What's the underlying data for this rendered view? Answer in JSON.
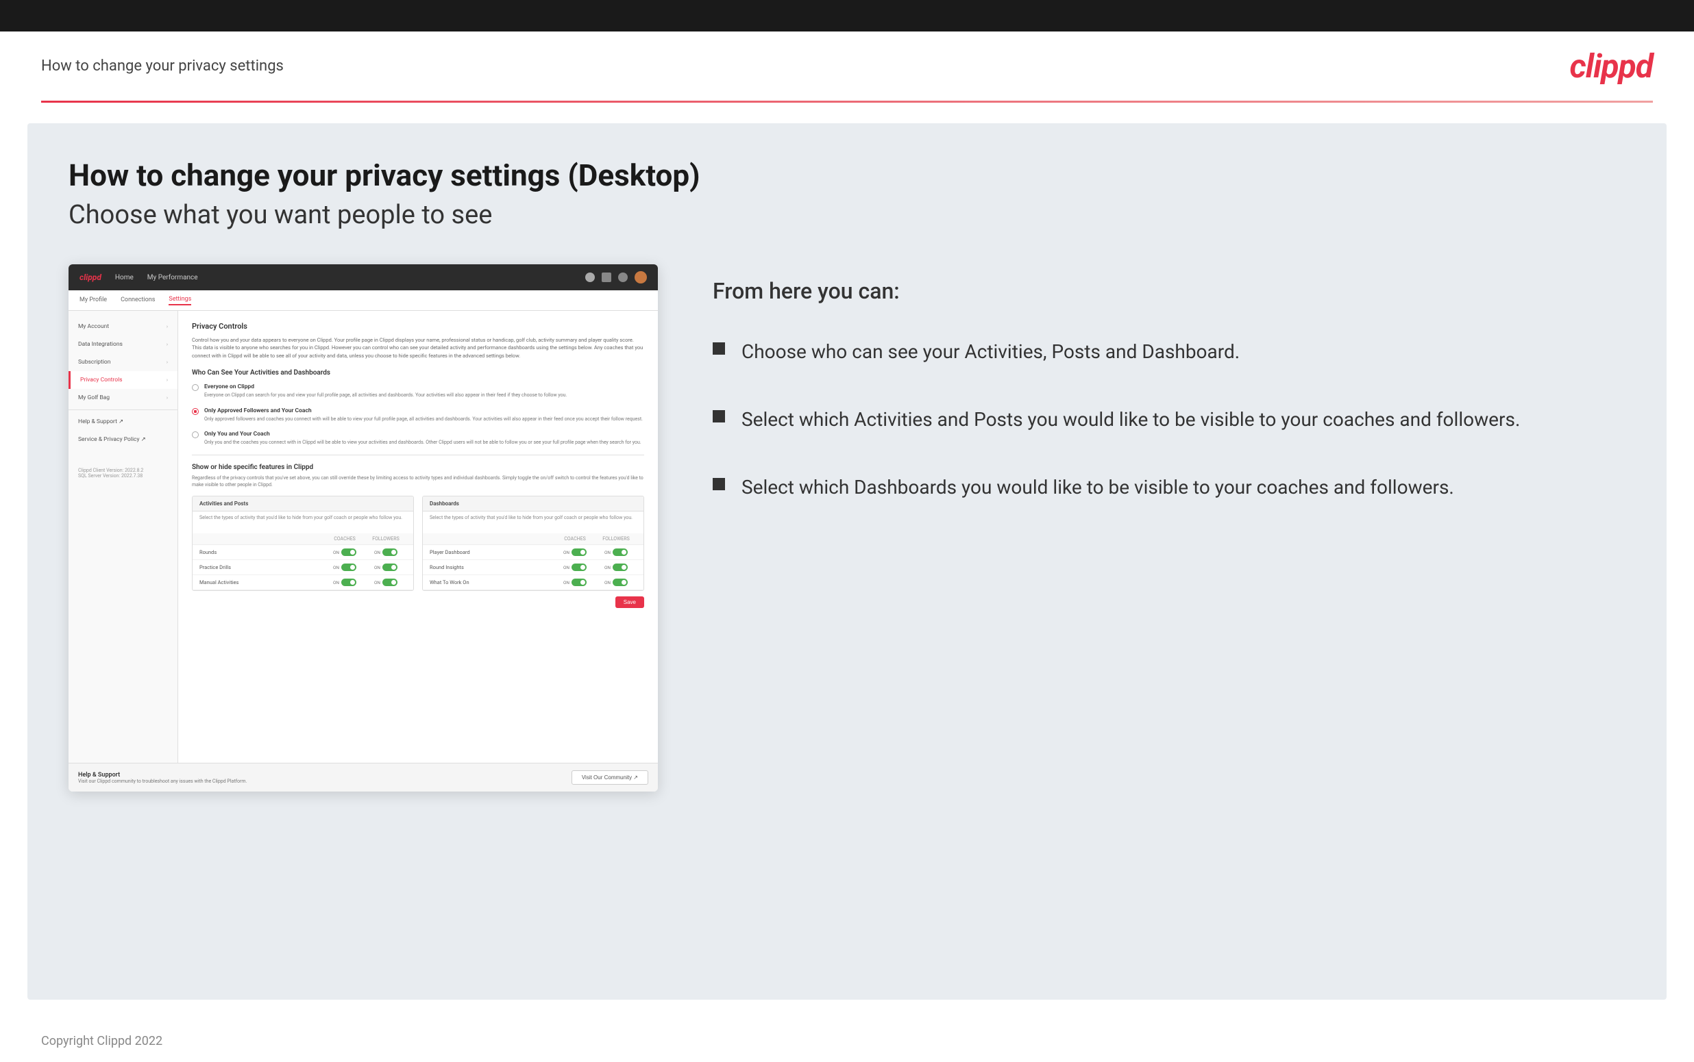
{
  "topBar": {},
  "header": {
    "title": "How to change your privacy settings",
    "logo": "clippd"
  },
  "page": {
    "heading": "How to change your privacy settings (Desktop)",
    "subheading": "Choose what you want people to see"
  },
  "mockup": {
    "nav": {
      "logo": "clippd",
      "links": [
        "Home",
        "My Performance"
      ],
      "icons": [
        "search",
        "grid",
        "settings",
        "user"
      ]
    },
    "subnav": [
      "My Profile",
      "Connections",
      "Settings"
    ],
    "activeSubnav": "Settings",
    "sidebar": {
      "items": [
        {
          "label": "My Account",
          "active": false
        },
        {
          "label": "Data Integrations",
          "active": false
        },
        {
          "label": "Subscription",
          "active": false
        },
        {
          "label": "Privacy Controls",
          "active": true
        },
        {
          "label": "My Golf Bag",
          "active": false
        },
        {
          "label": "Help & Support",
          "active": false,
          "external": true
        },
        {
          "label": "Service & Privacy Policy",
          "active": false,
          "external": true
        }
      ],
      "version": "Clippd Client Version: 2022.8.2\nSQL Server Version: 2022.7.38"
    },
    "mainPanel": {
      "sectionTitle": "Privacy Controls",
      "sectionDesc": "Control how you and your data appears to everyone on Clippd. Your profile page in Clippd displays your name, professional status or handicap, golf club, activity summary and player quality score. This data is visible to anyone who searches for you in Clippd. However you can control who can see your detailed activity and performance dashboards using the settings below. Any coaches that you connect with in Clippd will be able to see all of your activity and data, unless you choose to hide specific features in the advanced settings below.",
      "whoTitle": "Who Can See Your Activities and Dashboards",
      "options": [
        {
          "label": "Everyone on Clippd",
          "desc": "Everyone on Clippd can search for you and view your full profile page, all activities and dashboards. Your activities will also appear in their feed if they choose to follow you.",
          "selected": false
        },
        {
          "label": "Only Approved Followers and Your Coach",
          "desc": "Only approved followers and coaches you connect with will be able to view your full profile page, all activities and dashboards. Your activities will also appear in their feed once you accept their follow request.",
          "selected": true
        },
        {
          "label": "Only You and Your Coach",
          "desc": "Only you and the coaches you connect with in Clippd will be able to view your activities and dashboards. Other Clippd users will not be able to follow you or see your full profile page when they search for you.",
          "selected": false
        }
      ],
      "featuresTitle": "Show or hide specific features in Clippd",
      "featuresDesc": "Regardless of the privacy controls that you've set above, you can still override these by limiting access to activity types and individual dashboards. Simply toggle the on/off switch to control the features you'd like to make visible to other people in Clippd.",
      "activitiesTable": {
        "title": "Activities and Posts",
        "desc": "Select the types of activity that you'd like to hide from your golf coach or people who follow you.",
        "columns": [
          "COACHES",
          "FOLLOWERS"
        ],
        "rows": [
          {
            "label": "Rounds",
            "coachesOn": true,
            "followersOn": true
          },
          {
            "label": "Practice Drills",
            "coachesOn": true,
            "followersOn": true
          },
          {
            "label": "Manual Activities",
            "coachesOn": true,
            "followersOn": true
          }
        ]
      },
      "dashboardsTable": {
        "title": "Dashboards",
        "desc": "Select the types of activity that you'd like to hide from your golf coach or people who follow you.",
        "columns": [
          "COACHES",
          "FOLLOWERS"
        ],
        "rows": [
          {
            "label": "Player Dashboard",
            "coachesOn": true,
            "followersOn": true
          },
          {
            "label": "Round Insights",
            "coachesOn": true,
            "followersOn": true
          },
          {
            "label": "What To Work On",
            "coachesOn": true,
            "followersOn": true
          }
        ]
      },
      "saveLabel": "Save",
      "helpSection": {
        "title": "Help & Support",
        "desc": "Visit our Clippd community to troubleshoot any issues with the Clippd Platform.",
        "buttonLabel": "Visit Our Community"
      }
    }
  },
  "rightPanel": {
    "fromHereTitle": "From here you can:",
    "bullets": [
      "Choose who can see your Activities, Posts and Dashboard.",
      "Select which Activities and Posts you would like to be visible to your coaches and followers.",
      "Select which Dashboards you would like to be visible to your coaches and followers."
    ]
  },
  "footer": {
    "copyright": "Copyright Clippd 2022"
  }
}
